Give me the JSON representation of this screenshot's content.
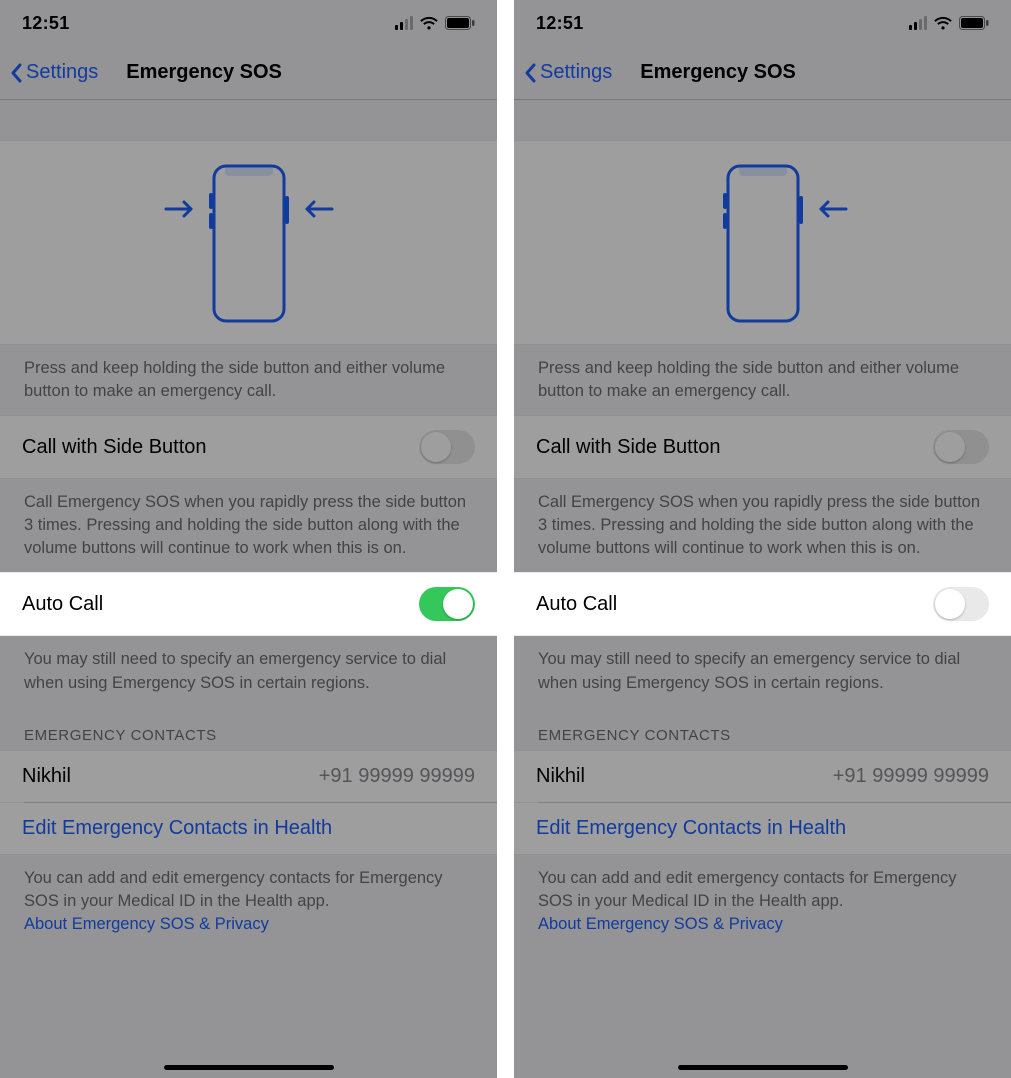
{
  "status": {
    "time": "12:51"
  },
  "nav": {
    "back": "Settings",
    "title": "Emergency SOS"
  },
  "diagram_footer": "Press and keep holding the side button and either volume button to make an emergency call.",
  "call_side": {
    "label": "Call with Side Button",
    "footer": "Call Emergency SOS when you rapidly press the side button 3 times. Pressing and holding the side button along with the volume buttons will continue to work when this is on."
  },
  "auto_call": {
    "label": "Auto Call",
    "footer": "You may still need to specify an emergency service to dial when using Emergency SOS in certain regions."
  },
  "contacts": {
    "header": "EMERGENCY CONTACTS",
    "items": [
      {
        "name": "Nikhil",
        "phone": "+91 99999 99999"
      }
    ],
    "edit_link": "Edit Emergency Contacts in Health",
    "footer": "You can add and edit emergency contacts for Emergency SOS in your Medical ID in the Health app.",
    "privacy_link": "About Emergency SOS & Privacy"
  },
  "screens": [
    {
      "auto_call_on": true
    },
    {
      "auto_call_on": false
    }
  ]
}
